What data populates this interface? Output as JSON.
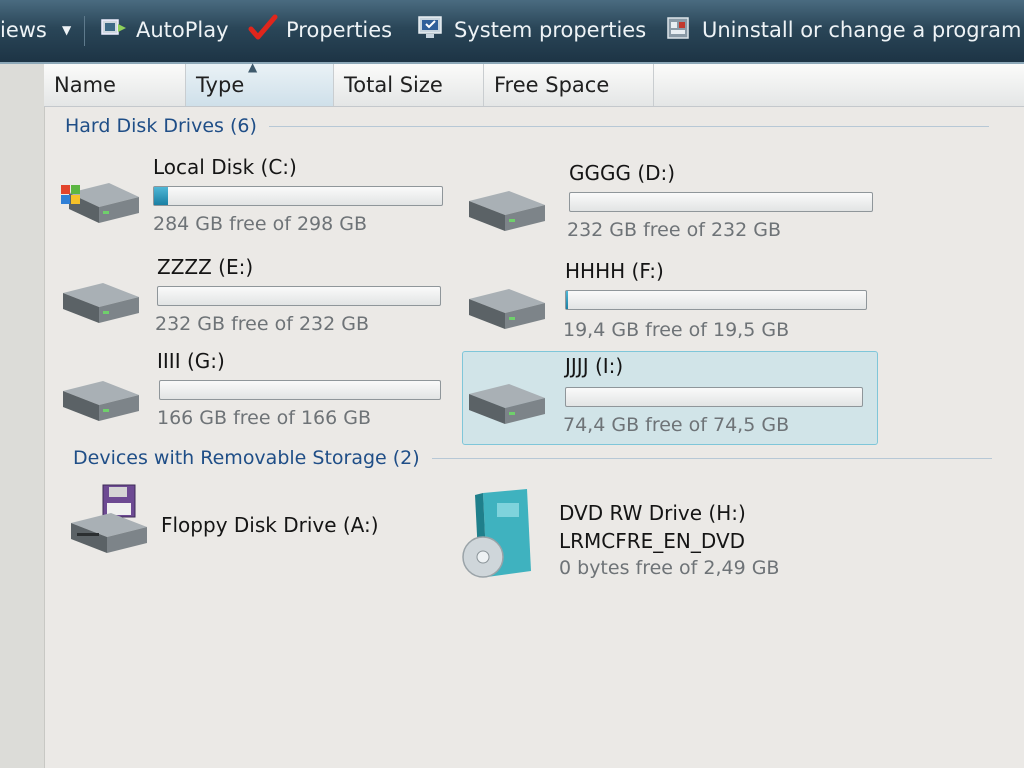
{
  "toolbar": {
    "items": [
      {
        "label": "iews",
        "icon": "views-icon"
      },
      {
        "label": "AutoPlay",
        "icon": "autoplay-icon"
      },
      {
        "label": "Properties",
        "icon": "properties-checkmark-icon"
      },
      {
        "label": "System properties",
        "icon": "system-properties-icon"
      },
      {
        "label": "Uninstall or change a program",
        "icon": "uninstall-program-icon"
      }
    ]
  },
  "columns": [
    {
      "label": "Name",
      "sorted": false
    },
    {
      "label": "Type",
      "sorted": true
    },
    {
      "label": "Total Size",
      "sorted": false
    },
    {
      "label": "Free Space",
      "sorted": false
    }
  ],
  "groups": {
    "hard_disks": {
      "label": "Hard Disk Drives (6)"
    },
    "removable": {
      "label": "Devices with Removable Storage (2)"
    }
  },
  "drives": [
    {
      "name": "Local Disk (C:)",
      "free": "284 GB free of 298 GB",
      "used_fraction": 0.047,
      "icon": "windows-hard-disk-icon",
      "selected": false
    },
    {
      "name": "GGGG (D:)",
      "free": "232 GB free of 232 GB",
      "used_fraction": 0.0,
      "icon": "hard-disk-icon",
      "selected": false
    },
    {
      "name": "ZZZZ (E:)",
      "free": "232 GB free of 232 GB",
      "used_fraction": 0.0,
      "icon": "hard-disk-icon",
      "selected": false
    },
    {
      "name": "HHHH (F:)",
      "free": "19,4 GB free of 19,5 GB",
      "used_fraction": 0.005,
      "icon": "hard-disk-icon",
      "selected": false
    },
    {
      "name": "IIII (G:)",
      "free": "166 GB free of 166 GB",
      "used_fraction": 0.0,
      "icon": "hard-disk-icon",
      "selected": false
    },
    {
      "name": "JJJJ (I:)",
      "free": "74,4 GB free of 74,5 GB",
      "used_fraction": 0.001,
      "icon": "hard-disk-icon",
      "selected": true
    }
  ],
  "devices": [
    {
      "name": "Floppy Disk Drive (A:)",
      "icon": "floppy-drive-icon"
    },
    {
      "name": "DVD RW Drive (H:)",
      "label": "LRMCFRE_EN_DVD",
      "free": "0 bytes free of 2,49 GB",
      "icon": "dvd-drive-icon"
    }
  ],
  "colors": {
    "toolbar": "#2a4658",
    "group_header": "#1f4e87",
    "bar_fill": "#1a7fa3",
    "selection": "#7fc6d9"
  }
}
